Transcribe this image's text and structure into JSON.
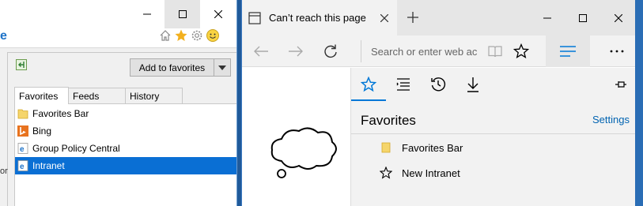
{
  "ie": {
    "logo_letter": "e",
    "add_to_favorites_label": "Add to favorites",
    "tabs": [
      {
        "label": "Favorites",
        "active": true
      },
      {
        "label": "Feeds",
        "active": false
      },
      {
        "label": "History",
        "active": false
      }
    ],
    "favorites": [
      {
        "label": "Favorites Bar",
        "icon": "folder-icon",
        "selected": false
      },
      {
        "label": "Bing",
        "icon": "bing-icon",
        "selected": false
      },
      {
        "label": "Group Policy Central",
        "icon": "ie-page-icon",
        "selected": false
      },
      {
        "label": "Intranet",
        "icon": "ie-page-icon",
        "selected": true
      }
    ],
    "edge_fragment_text": "or"
  },
  "edge": {
    "tab_title": "Can’t reach this page",
    "address_placeholder": "Search or enter web ac",
    "hub": {
      "heading": "Favorites",
      "settings_link": "Settings",
      "items": [
        {
          "label": "Favorites Bar",
          "icon": "folder-icon"
        },
        {
          "label": "New Intranet",
          "icon": "star-outline-icon"
        }
      ]
    }
  },
  "colors": {
    "accent": "#0078d7",
    "selection": "#0a6fd4",
    "folder": "#f5d56b",
    "star": "#f2b01e"
  }
}
